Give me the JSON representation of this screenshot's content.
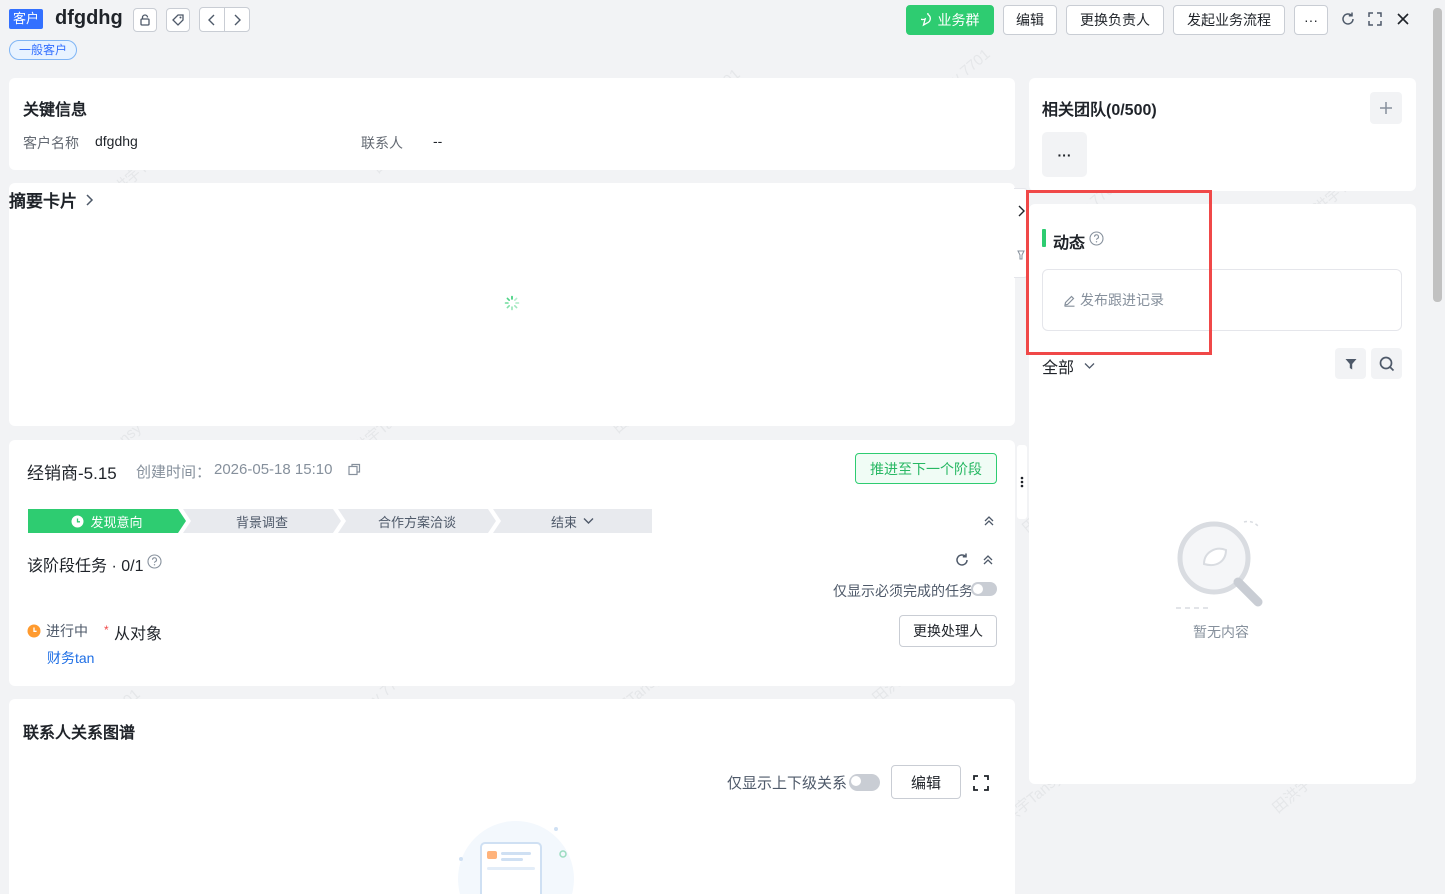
{
  "header": {
    "type_badge": "客户",
    "title": "dfgdhg",
    "tag": "一般客户",
    "buttons": {
      "business_group": "业务群",
      "edit": "编辑",
      "change_owner": "更换负责人",
      "start_flow": "发起业务流程",
      "more": "···"
    }
  },
  "key_info": {
    "title": "关键信息",
    "customer_name_label": "客户名称",
    "customer_name_value": "dfgdhg",
    "contact_label": "联系人",
    "contact_value": "--"
  },
  "summary": {
    "title": "摘要卡片"
  },
  "stage": {
    "name": "经销商-5.15",
    "created_label": "创建时间：",
    "created_value": "2026-05-18 15:10",
    "advance_button": "推进至下一个阶段",
    "stages": [
      "发现意向",
      "背景调查",
      "合作方案洽谈",
      "结束"
    ],
    "task_title": "该阶段任务 · 0/1",
    "only_required_label": "仅显示必须完成的任务",
    "task_status": "进行中",
    "task_name": "从对象",
    "task_assignee": "财务tan",
    "change_handler_button": "更换处理人"
  },
  "relation": {
    "title": "联系人关系图谱",
    "only_hierarchy_label": "仅显示上下级关系",
    "edit_button": "编辑"
  },
  "team": {
    "title": "相关团队(0/500)",
    "more": "···"
  },
  "activity": {
    "title": "动态",
    "post_placeholder": "发布跟进记录",
    "filter_label": "全部",
    "empty_text": "暂无内容"
  },
  "colors": {
    "accent_green": "#2ecc71",
    "badge_blue": "#3370ff",
    "link_blue": "#1f6fe5",
    "highlight_red": "#f04848",
    "in_progress_orange": "#ff9a2e"
  }
}
